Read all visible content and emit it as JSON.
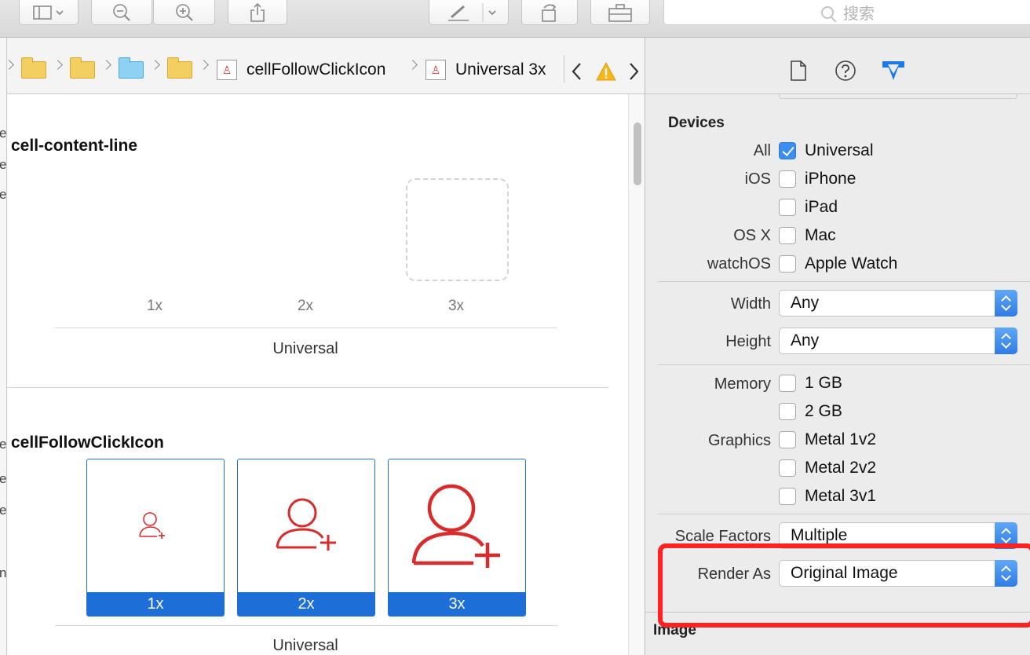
{
  "toolbar": {
    "search_placeholder": "搜索",
    "icons": [
      "sidebar-toggle-icon",
      "chevron-down-icon",
      "zoom-out-icon",
      "zoom-in-icon",
      "share-icon",
      "pen-icon",
      "chevron-down-icon",
      "rotate-icon",
      "toolbox-icon",
      "search-icon"
    ]
  },
  "left_strip": {
    "fragments": [
      "ev",
      "ev",
      "ev",
      "ev",
      "ev",
      "ev",
      "n"
    ]
  },
  "jumpbar": {
    "crumbs": [
      "cellFollowClickIcon",
      "Universal 3x"
    ],
    "icons": [
      "folder-icon",
      "folder-icon",
      "group-folder-icon",
      "folder-icon",
      "image-asset-icon",
      "image-asset-icon",
      "back-icon",
      "warning-icon",
      "forward-icon"
    ]
  },
  "canvas": {
    "sets": [
      {
        "title": "cell-content-line",
        "slots": [
          "1x",
          "2x",
          "3x"
        ],
        "idiom": "Universal"
      },
      {
        "title": "cellFollowClickIcon",
        "slots": [
          "1x",
          "2x",
          "3x"
        ],
        "idiom": "Universal"
      }
    ]
  },
  "inspector": {
    "tabs": [
      "file-inspector-icon",
      "quick-help-icon",
      "attributes-inspector-icon"
    ],
    "devices": {
      "heading": "Devices",
      "rows": [
        {
          "group": "All",
          "label": "Universal",
          "checked": true
        },
        {
          "group": "iOS",
          "label": "iPhone",
          "checked": false
        },
        {
          "group": "",
          "label": "iPad",
          "checked": false
        },
        {
          "group": "OS X",
          "label": "Mac",
          "checked": false
        },
        {
          "group": "watchOS",
          "label": "Apple Watch",
          "checked": false
        }
      ]
    },
    "width": {
      "label": "Width",
      "value": "Any"
    },
    "height": {
      "label": "Height",
      "value": "Any"
    },
    "memory": {
      "label": "Memory",
      "options": [
        "1 GB",
        "2 GB"
      ]
    },
    "graphics": {
      "label": "Graphics",
      "options": [
        "Metal 1v2",
        "Metal 2v2",
        "Metal 3v1"
      ]
    },
    "scale_factors": {
      "label": "Scale Factors",
      "value": "Multiple"
    },
    "render_as": {
      "label": "Render As",
      "value": "Original Image"
    },
    "image_heading": "Image"
  },
  "colors": {
    "accent": "#1d6ed6",
    "highlight": "#ff2222",
    "asset_red": "#d92b2b"
  }
}
